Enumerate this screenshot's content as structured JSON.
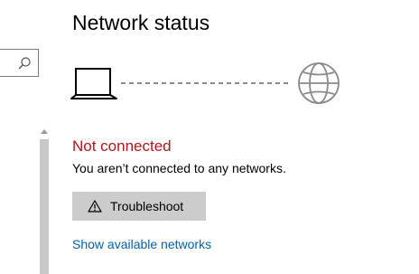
{
  "header": {
    "title": "Network status"
  },
  "status": {
    "title": "Not connected",
    "description": "You aren’t connected to any networks.",
    "title_color": "#b4151b"
  },
  "actions": {
    "troubleshoot_label": "Troubleshoot",
    "troubleshoot_icon": "warning-icon",
    "available_networks_link": "Show available networks",
    "link_color": "#0063b1"
  },
  "diagram": {
    "device_icon": "laptop-icon",
    "internet_icon": "globe-icon",
    "connection_state": "disconnected"
  },
  "sidebar": {
    "search_icon": "search-icon"
  }
}
